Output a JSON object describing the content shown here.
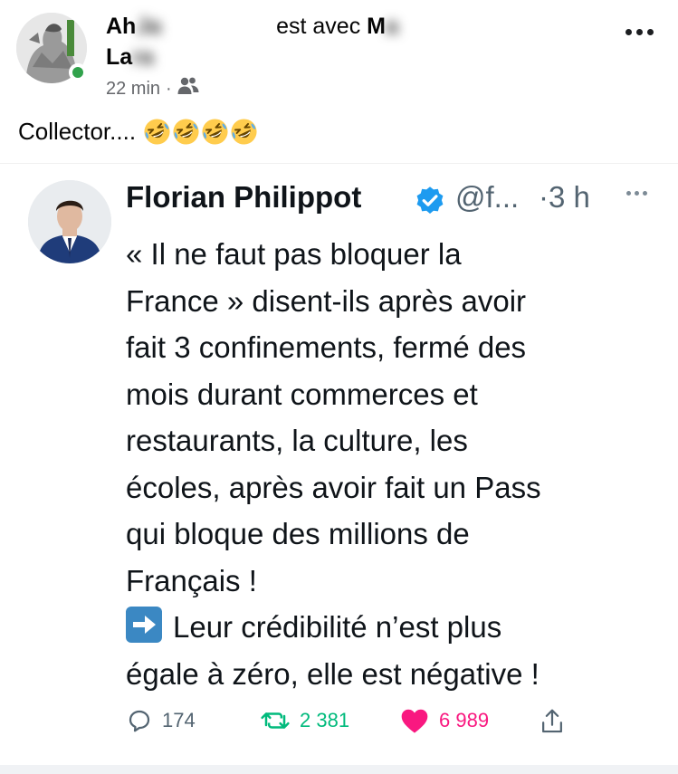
{
  "post": {
    "author_visible_start": "Ah",
    "author_blurred_1": "Ja",
    "connector_text": "est avec",
    "tagged_visible_start": "M",
    "tagged_blurred_1": "a",
    "author_line2_visible": "La",
    "author_line2_blurred": "ra",
    "time": "22 min",
    "separator": "·",
    "audience_icon": "friends-icon",
    "text": "Collector....",
    "emoji_name": "rolling-on-the-floor-laughing",
    "emoji_count": 4
  },
  "tweet": {
    "name": "Florian Philippot",
    "handle": "@f...",
    "time": "·3 h",
    "body_lines": [
      "« Il ne faut pas bloquer la",
      "France » disent-ils après avoir",
      "fait 3 confinements, fermé des",
      "mois durant commerces et",
      "restaurants, la culture, les",
      "écoles, après avoir fait un Pass",
      "qui bloque des millions de",
      "Français !",
      "Leur crédibilité n’est plus",
      "égale à zéro, elle est négative !"
    ],
    "actions": {
      "replies": "174",
      "retweets": "2 381",
      "likes": "6 989"
    }
  },
  "colors": {
    "online": "#31a24c",
    "verified": "#1d9bf0",
    "retweet": "#00ba7c",
    "like": "#f91880",
    "muted": "#536471"
  }
}
